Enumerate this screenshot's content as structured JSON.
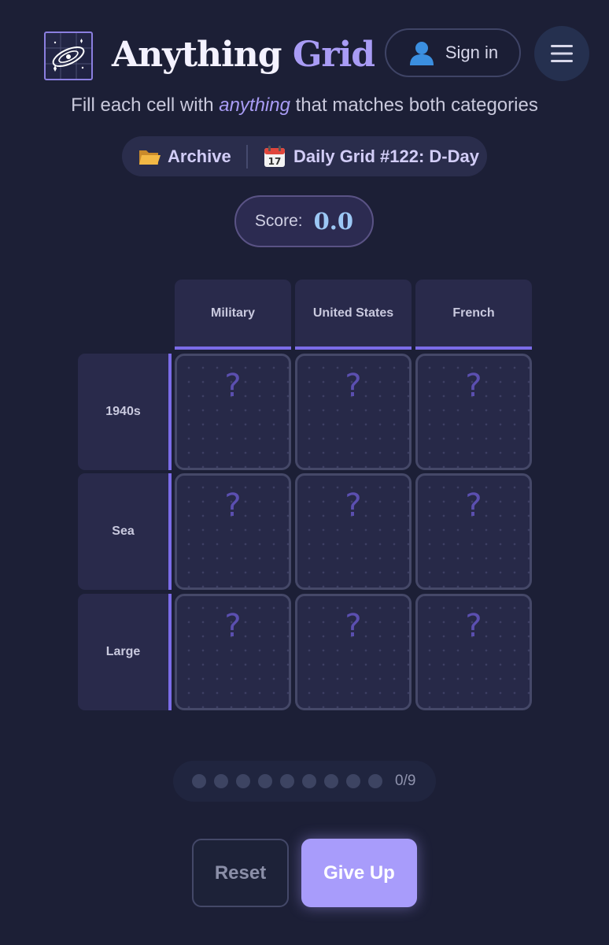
{
  "header": {
    "brand_word1": "Anything",
    "brand_word2": "Grid",
    "signin_label": "Sign in",
    "logo_icon": "galaxy-grid-icon",
    "menu_icon": "hamburger-menu-icon",
    "user_icon": "user-icon"
  },
  "tagline": {
    "before": "Fill each cell with ",
    "emphasis": "anything",
    "after": " that matches both categories"
  },
  "nav": {
    "archive_label": "Archive",
    "archive_icon": "open-folder-icon",
    "daily_label": "Daily Grid #122: D-Day",
    "daily_icon": "calendar-icon"
  },
  "score": {
    "label": "Score:",
    "value": "0.0"
  },
  "grid": {
    "columns": [
      "Military",
      "United States",
      "French"
    ],
    "rows": [
      "1940s",
      "Sea",
      "Large"
    ],
    "cells": [
      [
        "?",
        "?",
        "?"
      ],
      [
        "?",
        "?",
        "?"
      ],
      [
        "?",
        "?",
        "?"
      ]
    ]
  },
  "progress": {
    "filled": 0,
    "total": 9,
    "label": "0/9"
  },
  "actions": {
    "reset_label": "Reset",
    "giveup_label": "Give Up"
  },
  "colors": {
    "background": "#1c1f36",
    "accent": "#a89cfb",
    "header_border": "#7b6ce8",
    "score_value": "#9cc8f5"
  }
}
